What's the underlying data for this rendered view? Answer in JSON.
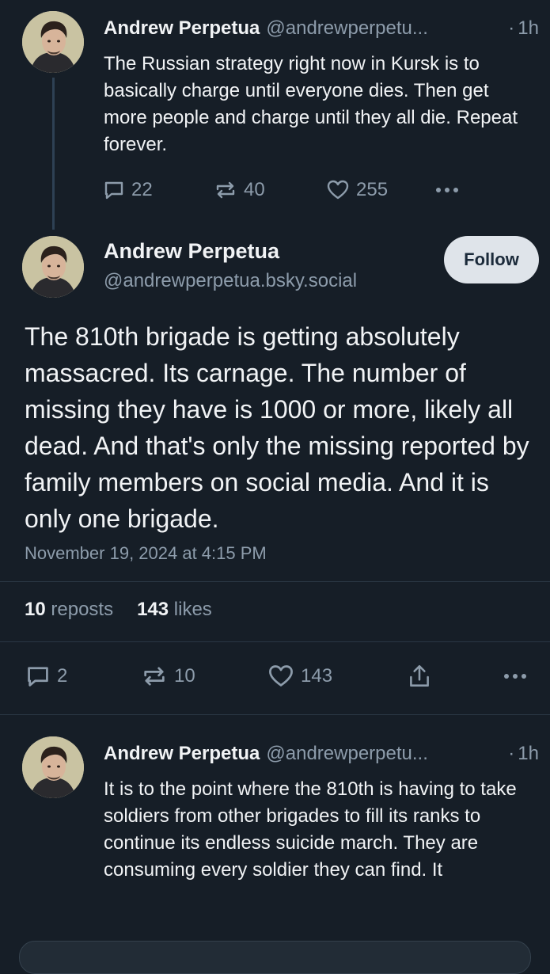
{
  "reply_above": {
    "author_name": "Andrew Perpetua",
    "handle": "@andrewperpetu...",
    "separator": "·",
    "time": "1h",
    "text": "The Russian strategy right now in Kursk is to basically charge until everyone dies. Then get more people and charge until they all die. Repeat forever.",
    "reply_count": "22",
    "repost_count": "40",
    "like_count": "255"
  },
  "main_post": {
    "author_name": "Andrew Perpetua",
    "handle": "@andrewperpetua.bsky.social",
    "follow_label": "Follow",
    "text": "The 810th brigade is getting absolutely massacred. Its carnage. The number of missing they have is 1000 or more, likely all dead. And that's only the missing reported by family members on social media. And it is only one brigade.",
    "date": "November 19, 2024 at 4:15 PM",
    "reposts_count": "10",
    "reposts_label": "reposts",
    "likes_count": "143",
    "likes_label": "likes",
    "reply_count": "2",
    "repost_count": "10",
    "like_count": "143"
  },
  "reply_below": {
    "author_name": "Andrew Perpetua",
    "handle": "@andrewperpetu...",
    "separator": "·",
    "time": "1h",
    "text": "It is to the point where the 810th is having to take soldiers from other brigades to fill its ranks to continue its endless suicide march. They are consuming every soldier they can find. It"
  },
  "icons": {
    "reply": "reply-icon",
    "repost": "repost-icon",
    "like": "heart-icon",
    "share": "share-icon",
    "more": "more-icon"
  },
  "colors": {
    "background": "#161e27",
    "text": "#f1f3f5",
    "muted": "#8d9cab",
    "follow_bg": "#dfe4ea"
  }
}
